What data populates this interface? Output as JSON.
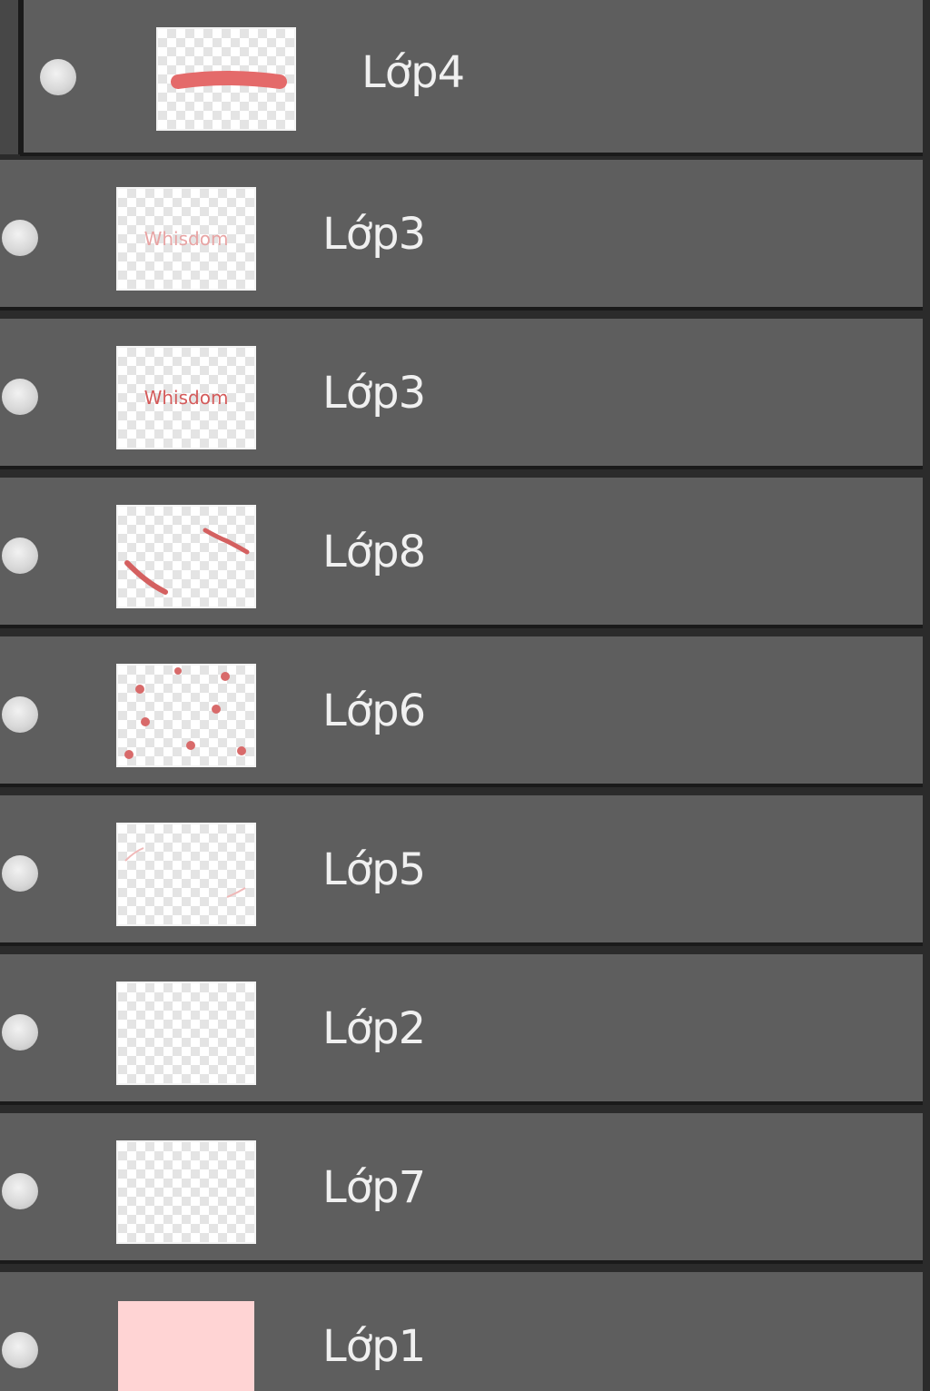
{
  "layers": [
    {
      "name": "Lớp4",
      "thumb": "stroke",
      "thumb_color": "#e46a6a"
    },
    {
      "name": "Lớp3",
      "thumb": "text-faint",
      "thumb_color": "#e08a8a"
    },
    {
      "name": "Lớp3",
      "thumb": "text",
      "thumb_color": "#d46060"
    },
    {
      "name": "Lớp8",
      "thumb": "diagonals",
      "thumb_color": "#d46060"
    },
    {
      "name": "Lớp6",
      "thumb": "dots",
      "thumb_color": "#d86a6a"
    },
    {
      "name": "Lớp5",
      "thumb": "faint-lines",
      "thumb_color": "#f0b8b8"
    },
    {
      "name": "Lớp2",
      "thumb": "empty",
      "thumb_color": ""
    },
    {
      "name": "Lớp7",
      "thumb": "empty",
      "thumb_color": ""
    },
    {
      "name": "Lớp1",
      "thumb": "solid",
      "thumb_color": "#ffd4d4"
    }
  ],
  "thumb_text": "Whisdom",
  "colors": {
    "row_bg": "#5e5e5e",
    "separator": "#1a1a1a",
    "label": "#f0f0f0"
  }
}
